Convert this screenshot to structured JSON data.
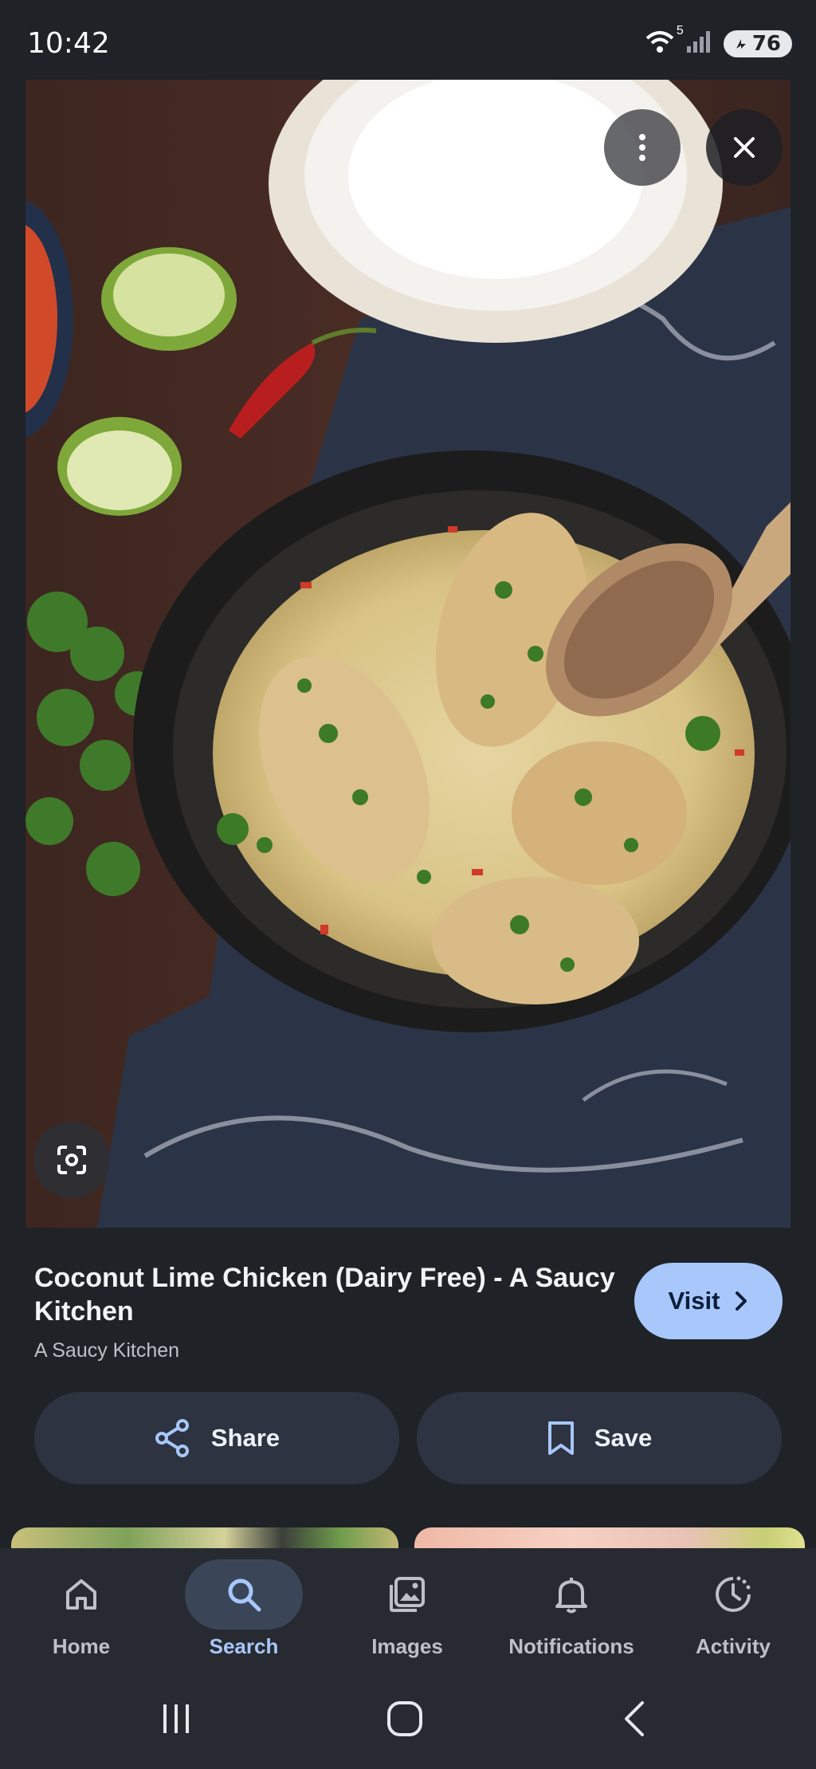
{
  "status_bar": {
    "time": "10:42",
    "wifi_badge": "5",
    "battery": "76",
    "icons": [
      "wifi-icon",
      "signal-icon",
      "battery-icon"
    ]
  },
  "image_viewer": {
    "overlay_buttons": [
      "more-vert-icon",
      "close-icon",
      "lens-icon"
    ]
  },
  "result": {
    "title": "Coconut Lime Chicken (Dairy Free) - A Saucy Kitchen",
    "source": "A Saucy Kitchen",
    "visit_label": "Visit"
  },
  "actions": {
    "share_label": "Share",
    "save_label": "Save"
  },
  "bottom_nav": {
    "items": [
      {
        "label": "Home",
        "icon": "home-icon",
        "active": false
      },
      {
        "label": "Search",
        "icon": "search-icon",
        "active": true
      },
      {
        "label": "Images",
        "icon": "images-icon",
        "active": false
      },
      {
        "label": "Notifications",
        "icon": "bell-icon",
        "active": false
      },
      {
        "label": "Activity",
        "icon": "activity-icon",
        "active": false
      }
    ]
  },
  "system_nav": [
    "recents-icon",
    "home-circle-icon",
    "back-icon"
  ],
  "colors": {
    "background": "#1f2227",
    "accent": "#a8c7fa",
    "button_bg": "#2d3340",
    "nav_active_pill": "#3a4658"
  }
}
